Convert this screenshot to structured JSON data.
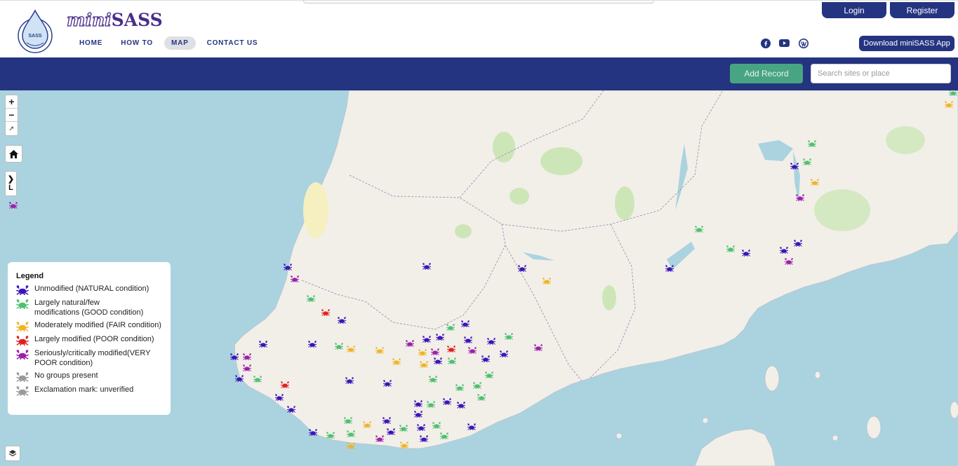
{
  "brand": {
    "mini": "mini",
    "sass": "SASS",
    "logo_text": "SASS"
  },
  "nav": [
    {
      "label": "HOME",
      "active": false
    },
    {
      "label": "HOW TO",
      "active": false
    },
    {
      "label": "MAP",
      "active": true
    },
    {
      "label": "CONTACT US",
      "active": false
    }
  ],
  "auth": {
    "login": "Login",
    "register": "Register"
  },
  "social": [
    {
      "icon": "facebook-icon"
    },
    {
      "icon": "youtube-icon"
    },
    {
      "icon": "wordpress-icon"
    }
  ],
  "download_label": "Download miniSASS App",
  "toolbar": {
    "add_record": "Add Record",
    "search_placeholder": "Search sites or place"
  },
  "map_controls": {
    "zoom_in": "+",
    "zoom_out": "−",
    "reset": "➚",
    "panel_toggle_arrow": "❯",
    "panel_toggle_letter": "L"
  },
  "legend": {
    "title": "Legend",
    "items": [
      {
        "label": "Unmodified (NATURAL condition)",
        "color": "#3b14b8"
      },
      {
        "label": "Largely natural/few modifications (GOOD condition)",
        "color": "#4fbf6f"
      },
      {
        "label": "Moderately modified (FAIR condition)",
        "color": "#f0b429"
      },
      {
        "label": "Largely modified (POOR condition)",
        "color": "#e02020"
      },
      {
        "label": "Seriously/critically modified(VERY POOR condition)",
        "color": "#9b1fa8"
      },
      {
        "label": "No groups present",
        "color": "#9a9a9a"
      },
      {
        "label": "Exclamation mark: unverified",
        "color": "#9a9a9a"
      }
    ]
  },
  "colors": {
    "natural": "#3b14b8",
    "good": "#4fbf6f",
    "fair": "#f0b429",
    "poor": "#e02020",
    "very_poor": "#9b1fa8",
    "unverified": "#22c6d8",
    "nav": "#243480",
    "sea": "#aad3df",
    "land": "#f2efe9"
  }
}
